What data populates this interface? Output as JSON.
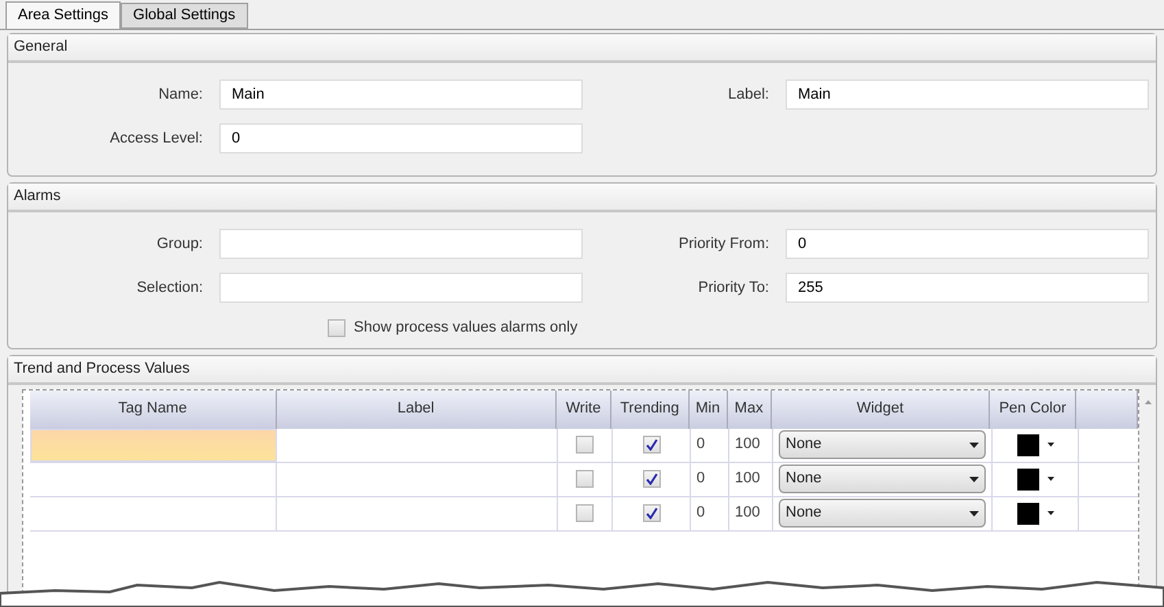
{
  "tabs": [
    {
      "label": "Area Settings",
      "selected": true
    },
    {
      "label": "Global Settings",
      "selected": false
    }
  ],
  "general": {
    "title": "General",
    "fields": [
      {
        "label": "Name:",
        "value": "Main"
      },
      {
        "label": "Label:",
        "value": "Main"
      },
      {
        "label": "Access Level:",
        "value": "0"
      }
    ]
  },
  "alarms": {
    "title": "Alarms",
    "fields": [
      {
        "label": "Group:"
      },
      {
        "label": "Priority From:",
        "value": "0"
      },
      {
        "label": "Selection:"
      },
      {
        "label": "Priority To:",
        "value": "255"
      }
    ],
    "checkbox": {
      "label": "Show process values alarms only",
      "checked": false
    }
  },
  "trend": {
    "title": "Trend and Process Values",
    "table": {
      "columns": [
        "Tag Name",
        "Label",
        "Write",
        "Trending",
        "Min",
        "Max",
        "Widget",
        "Pen Color"
      ],
      "rows": [
        {
          "selected": true,
          "write": false,
          "trending": true,
          "min": "0",
          "max": "100",
          "widget": "None",
          "color": "#000000"
        },
        {
          "selected": false,
          "write": false,
          "trending": true,
          "min": "0",
          "max": "100",
          "widget": "None",
          "color": "#000000"
        },
        {
          "selected": false,
          "write": false,
          "trending": true,
          "min": "0",
          "max": "100",
          "widget": "None",
          "color": "#000000"
        }
      ]
    }
  }
}
